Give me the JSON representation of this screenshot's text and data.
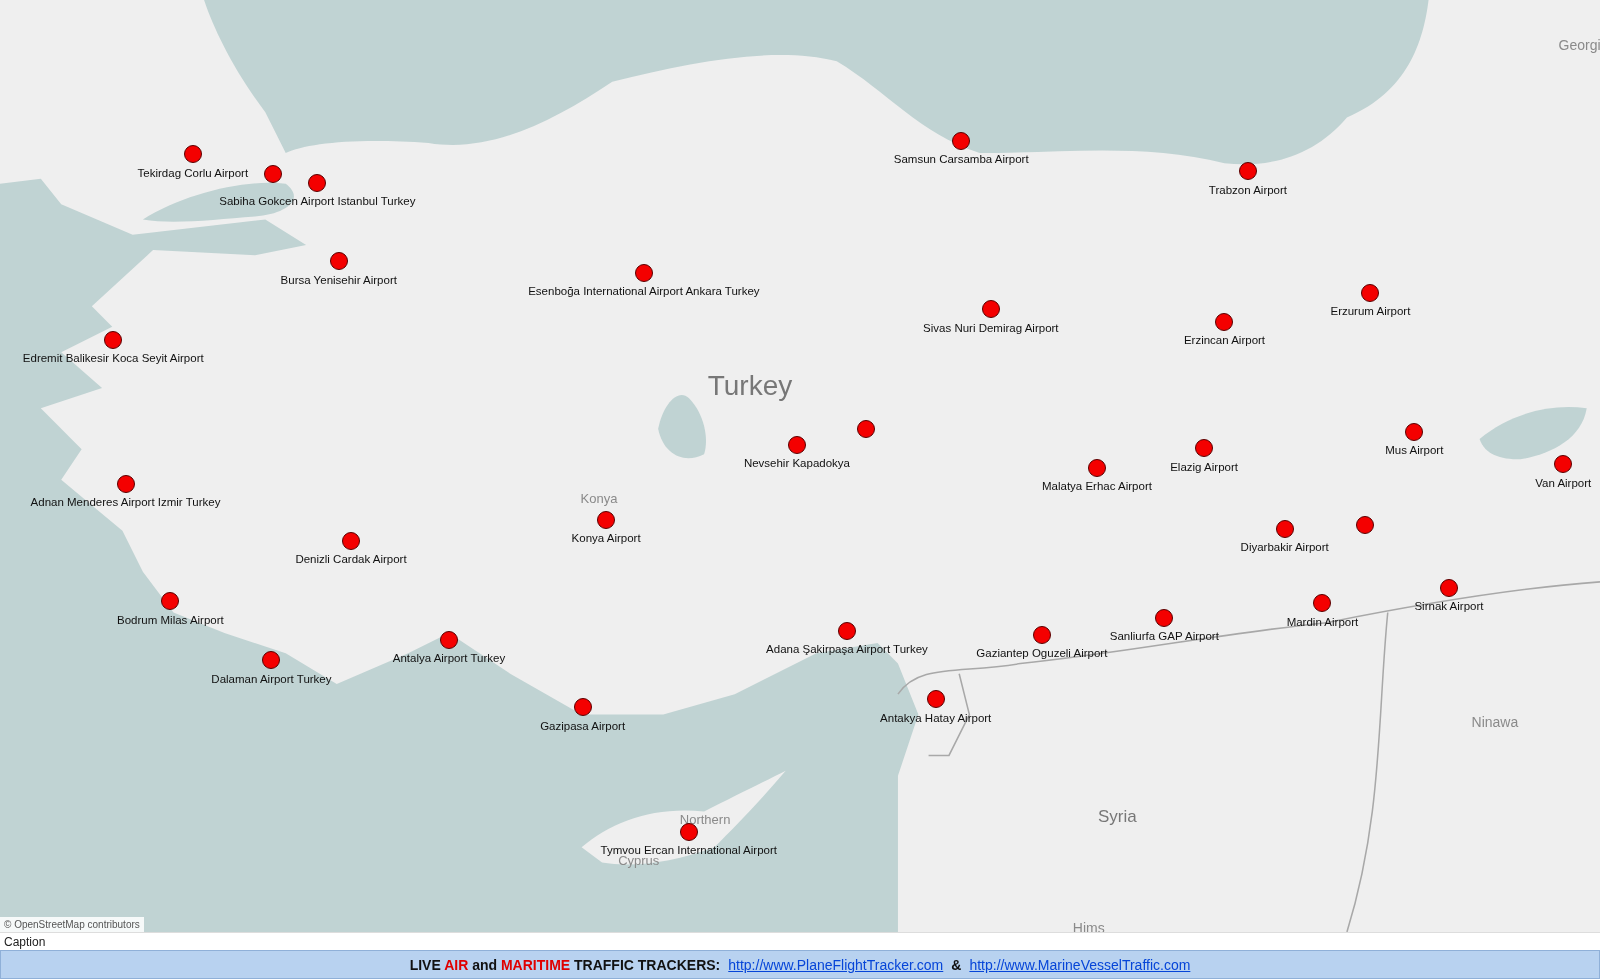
{
  "map": {
    "place_labels": [
      {
        "text": "Turkey",
        "kind": "country"
      },
      {
        "text": "Konya",
        "kind": "city"
      },
      {
        "text": "Syria",
        "kind": "country"
      },
      {
        "text": "Ninawa",
        "kind": "region"
      },
      {
        "text": "Hims",
        "kind": "region"
      },
      {
        "text": "Georgi",
        "kind": "region"
      },
      {
        "text": "Northern",
        "kind": "city"
      },
      {
        "text": "Cyprus",
        "kind": "city"
      }
    ],
    "airports": [
      {
        "label": "Tekirdag Corlu Airport"
      },
      {
        "label": "Sabiha Gokcen Airport Istanbul Turkey"
      },
      {
        "kind": "dot"
      },
      {
        "label": "Bursa Yenisehir Airport"
      },
      {
        "label": "Edremit Balikesir Koca Seyit Airport"
      },
      {
        "label": "Esenboğa International Airport Ankara Turkey"
      },
      {
        "label": "Samsun Carsamba Airport"
      },
      {
        "label": "Trabzon Airport"
      },
      {
        "label": "Sivas Nuri Demirag Airport"
      },
      {
        "label": "Erzincan Airport"
      },
      {
        "label": "Erzurum Airport"
      },
      {
        "label": "Adnan Menderes Airport Izmir Turkey"
      },
      {
        "label": "Denizli Cardak Airport"
      },
      {
        "label": "Konya Airport"
      },
      {
        "label": "Nevsehir Kapadokya"
      },
      {
        "kind": "dot"
      },
      {
        "label": "Malatya Erhac Airport"
      },
      {
        "label": "Elazig Airport"
      },
      {
        "label": "Mus Airport"
      },
      {
        "label": "Van Airport"
      },
      {
        "label": "Diyarbakir Airport"
      },
      {
        "kind": "dot"
      },
      {
        "label": "Bodrum Milas Airport"
      },
      {
        "label": "Dalaman Airport Turkey"
      },
      {
        "label": "Antalya Airport Turkey"
      },
      {
        "label": "Gazipasa Airport"
      },
      {
        "label": "Adana Şakirpaşa Airport Turkey"
      },
      {
        "label": "Gaziantep Oguzeli Airport"
      },
      {
        "label": "Sanliurfa GAP Airport"
      },
      {
        "label": "Mardin Airport"
      },
      {
        "label": "Sirnak Airport"
      },
      {
        "label": "Antakya Hatay Airport"
      },
      {
        "label": "Tymvou Ercan International Airport"
      }
    ],
    "attribution": "© OpenStreetMap contributors"
  },
  "caption": "Caption",
  "banner": {
    "segments": [
      {
        "text": "LIVE",
        "highlight": false
      },
      {
        "text": "AIR",
        "highlight": true
      },
      {
        "text": "and",
        "highlight": false
      },
      {
        "text": "MARITIME",
        "highlight": true
      },
      {
        "text": "TRAFFIC TRACKERS:",
        "highlight": false
      }
    ],
    "links": [
      "http://www.PlaneFlightTracker.com",
      "http://www.MarineVesselTraffic.com"
    ],
    "separator": "&"
  }
}
